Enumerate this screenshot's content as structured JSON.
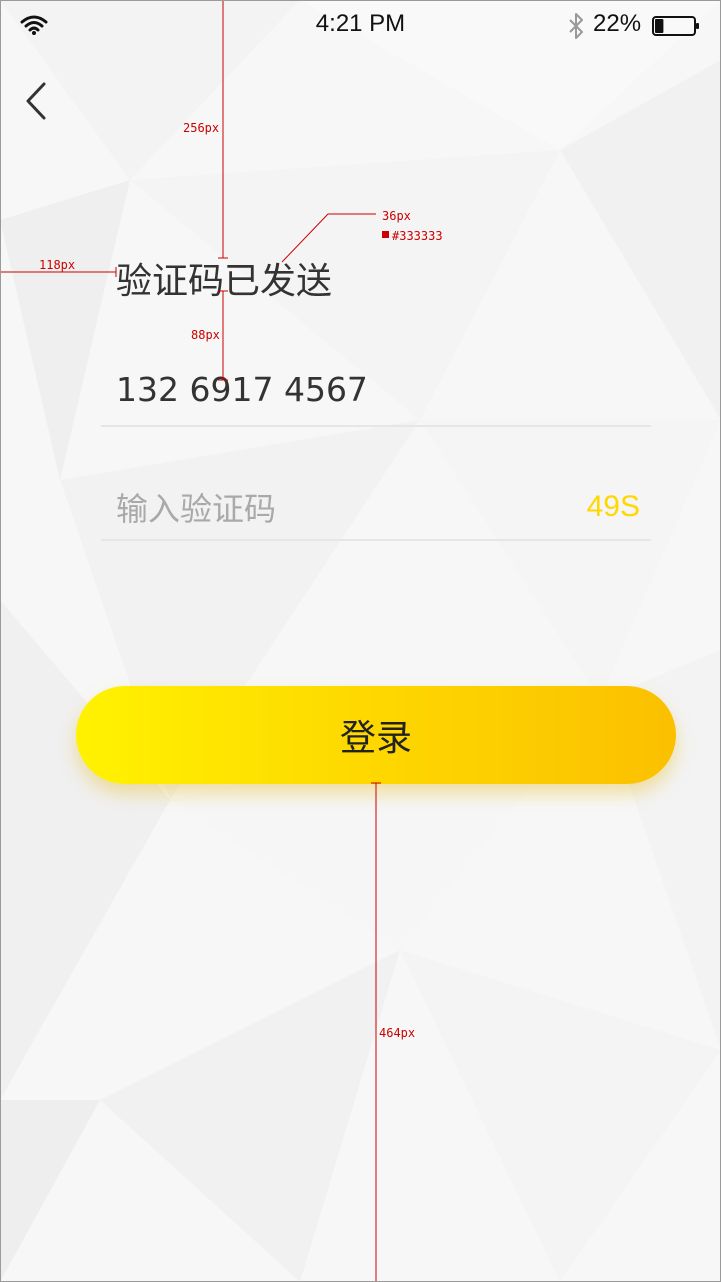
{
  "status_bar": {
    "time": "4:21 PM",
    "battery_percent": "22%",
    "battery_level": 0.22,
    "icons": [
      "wifi-icon",
      "bluetooth-icon",
      "battery-icon"
    ]
  },
  "nav": {
    "back_icon": "chevron-left-icon"
  },
  "title": "验证码已发送",
  "phone_number": "132 6917 4567",
  "code_field": {
    "placeholder": "输入验证码",
    "value": ""
  },
  "countdown": "49S",
  "login_button": {
    "label": "登录"
  },
  "annotations": {
    "top_spacing": "256px",
    "left_spacing": "118px",
    "title_to_phone": "88px",
    "font_size": "36px",
    "text_color": "#333333",
    "bottom_spacing": "464px"
  },
  "colors": {
    "text": "#333333",
    "placeholder": "#a9a9a9",
    "accent": "#ffd800",
    "button_gradient_start": "#fff200",
    "button_gradient_end": "#fbc000",
    "divider": "#e6e6e6",
    "annotation": "#cc0000"
  }
}
